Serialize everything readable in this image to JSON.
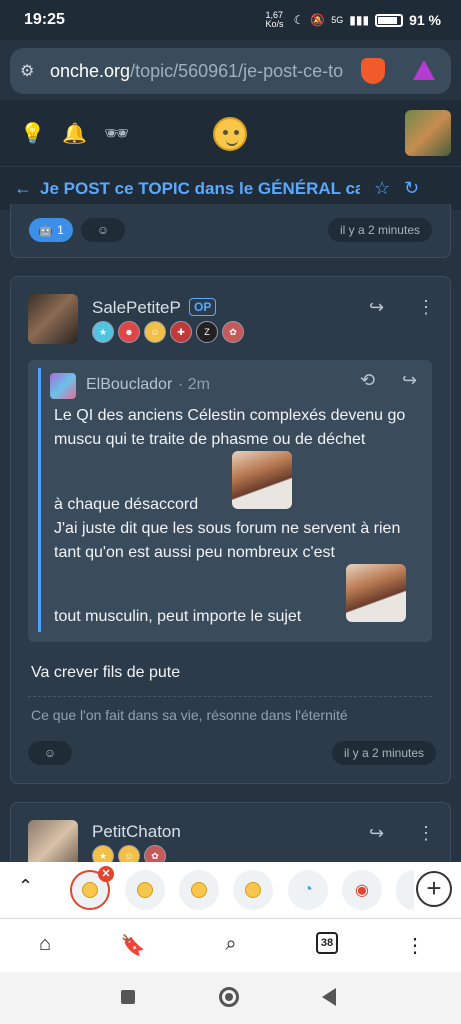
{
  "status_bar": {
    "time": "19:25",
    "speed": "1,67 Ko/s",
    "battery": "91 %",
    "network": "5G"
  },
  "browser": {
    "url_domain": "onche.org",
    "url_path": "/topic/560961/je-post-ce-to"
  },
  "topic": {
    "title": "Je POST ce TOPIC dans le GÉNÉRAL car i"
  },
  "prev_post": {
    "reaction_count": "1",
    "time": "il y a 2 minutes"
  },
  "post": {
    "author": "SalePetiteP",
    "op_label": "OP",
    "quote": {
      "author": "ElBouclador",
      "time": "· 2m",
      "line1": "Le QI des anciens Célestin complexés devenu go muscu qui te traite de phasme ou de déchet",
      "line2": "à chaque désaccord",
      "line3": "J'ai juste dit que les sous forum ne servent à rien tant qu'on est aussi peu nombreux c'est",
      "line4": "tout musculin, peut importe le sujet"
    },
    "message": "Va crever fils de pute",
    "signature": "Ce que l'on fait dans sa vie, résonne dans l'éternité",
    "time": "il y a 2 minutes"
  },
  "next_post": {
    "author": "PetitChaton"
  },
  "bottom_nav": {
    "tab_count": "38"
  },
  "colors": {
    "accent": "#5aa9ff",
    "background": "#263442",
    "card": "#2c3b4a"
  }
}
